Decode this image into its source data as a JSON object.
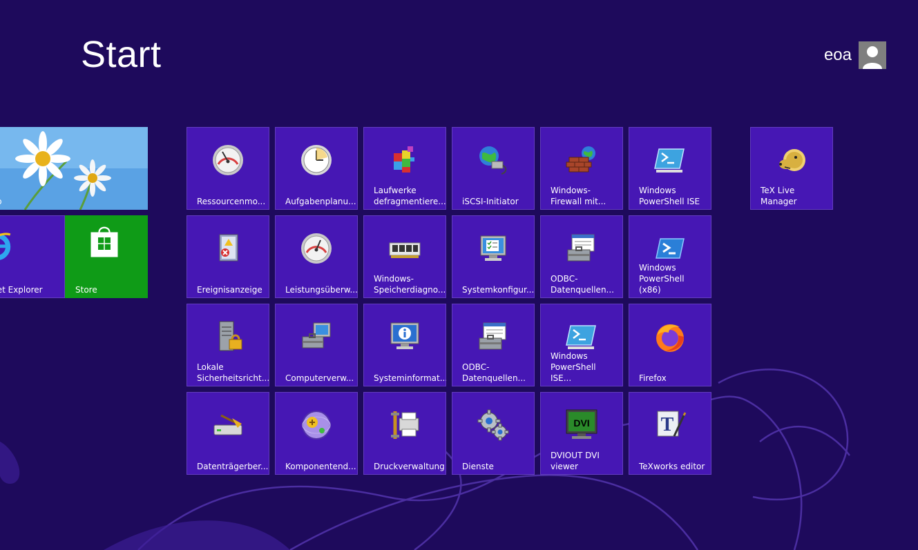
{
  "header": {
    "title": "Start"
  },
  "user": {
    "name": "eoa",
    "avatar_icon": "user-silhouette-icon"
  },
  "colors": {
    "background": "#1e0a5c",
    "tile": "#4617b4",
    "store": "#0f9b17",
    "desktop": "#5ea4e6"
  },
  "pinned": {
    "desktop": {
      "label": "ktop",
      "icon": "daisy-wallpaper-icon"
    },
    "ie": {
      "label": "ernet Explorer",
      "icon": "internet-explorer-icon"
    },
    "store": {
      "label": "Store",
      "icon": "store-bag-icon"
    }
  },
  "tiles": {
    "ressourcenmonitor": {
      "label": "Ressourcenmo...",
      "icon": "gauge-icon"
    },
    "aufgabenplanung": {
      "label": "Aufgabenplanu...",
      "icon": "clock-icon"
    },
    "laufwerke": {
      "label": "Laufwerke\ndefragmentiere...",
      "icon": "defrag-blocks-icon"
    },
    "iscsi": {
      "label": "iSCSI-Initiator",
      "icon": "globe-network-icon"
    },
    "firewall": {
      "label": "Windows-\nFirewall mit...",
      "icon": "firewall-icon"
    },
    "powershell_ise": {
      "label": "Windows\nPowerShell ISE",
      "icon": "powershell-ise-icon"
    },
    "texlive": {
      "label": "TeX Live\nManager",
      "icon": "tex-lion-icon"
    },
    "ereignisanzeige": {
      "label": "Ereignisanzeige",
      "icon": "event-log-icon"
    },
    "leistung": {
      "label": "Leistungsüberw...",
      "icon": "gauge-icon"
    },
    "speicherdiagnose": {
      "label": "Windows-\nSpeicherdiagno...",
      "icon": "memory-chip-icon"
    },
    "systemkonfig": {
      "label": "Systemkonfigur...",
      "icon": "system-config-icon"
    },
    "odbc1": {
      "label": "ODBC-\nDatenquellen...",
      "icon": "odbc-toolbox-icon"
    },
    "powershell_x86": {
      "label": "Windows\nPowerShell (x86)",
      "icon": "powershell-icon"
    },
    "lokale_sicherheit": {
      "label": "Lokale\nSicherheitsricht...",
      "icon": "server-lock-icon"
    },
    "computerverwaltung": {
      "label": "Computerverw...",
      "icon": "computer-management-icon"
    },
    "systeminformation": {
      "label": "Systeminformat...",
      "icon": "system-info-icon"
    },
    "odbc2": {
      "label": "ODBC-\nDatenquellen...",
      "icon": "odbc-toolbox-icon"
    },
    "powershell_ise_x86": {
      "label": "Windows\nPowerShell ISE...",
      "icon": "powershell-ise-icon"
    },
    "firefox": {
      "label": "Firefox",
      "icon": "firefox-icon"
    },
    "datentraeger": {
      "label": "Datenträgerber...",
      "icon": "disk-cleanup-icon"
    },
    "komponenten": {
      "label": "Komponentend...",
      "icon": "component-services-icon"
    },
    "druckverwaltung": {
      "label": "Druckverwaltung",
      "icon": "printer-icon"
    },
    "dienste": {
      "label": "Dienste",
      "icon": "gears-icon"
    },
    "dviout": {
      "label": "DVIOUT DVI\nviewer",
      "icon": "dvi-monitor-icon"
    },
    "texworks": {
      "label": "TeXworks editor",
      "icon": "texworks-icon"
    }
  },
  "dvi_text": "DVI"
}
